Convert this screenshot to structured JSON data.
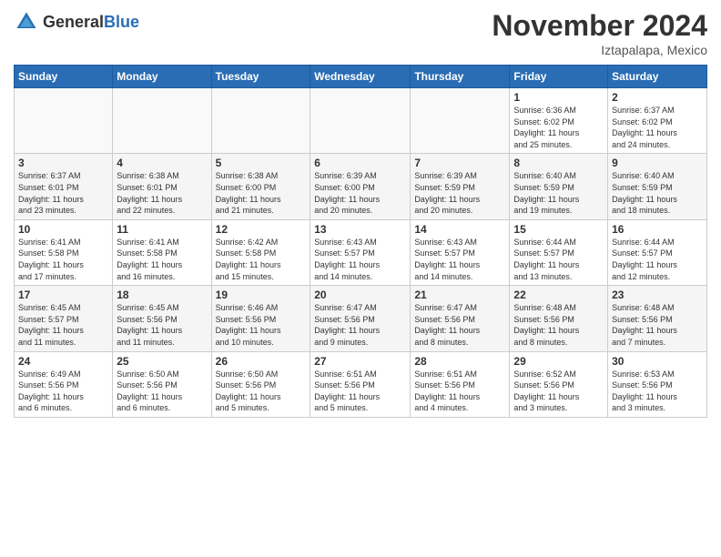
{
  "logo": {
    "text_general": "General",
    "text_blue": "Blue"
  },
  "title": "November 2024",
  "location": "Iztapalapa, Mexico",
  "days_of_week": [
    "Sunday",
    "Monday",
    "Tuesday",
    "Wednesday",
    "Thursday",
    "Friday",
    "Saturday"
  ],
  "weeks": [
    {
      "days": [
        {
          "num": "",
          "info": ""
        },
        {
          "num": "",
          "info": ""
        },
        {
          "num": "",
          "info": ""
        },
        {
          "num": "",
          "info": ""
        },
        {
          "num": "",
          "info": ""
        },
        {
          "num": "1",
          "info": "Sunrise: 6:36 AM\nSunset: 6:02 PM\nDaylight: 11 hours\nand 25 minutes."
        },
        {
          "num": "2",
          "info": "Sunrise: 6:37 AM\nSunset: 6:02 PM\nDaylight: 11 hours\nand 24 minutes."
        }
      ]
    },
    {
      "days": [
        {
          "num": "3",
          "info": "Sunrise: 6:37 AM\nSunset: 6:01 PM\nDaylight: 11 hours\nand 23 minutes."
        },
        {
          "num": "4",
          "info": "Sunrise: 6:38 AM\nSunset: 6:01 PM\nDaylight: 11 hours\nand 22 minutes."
        },
        {
          "num": "5",
          "info": "Sunrise: 6:38 AM\nSunset: 6:00 PM\nDaylight: 11 hours\nand 21 minutes."
        },
        {
          "num": "6",
          "info": "Sunrise: 6:39 AM\nSunset: 6:00 PM\nDaylight: 11 hours\nand 20 minutes."
        },
        {
          "num": "7",
          "info": "Sunrise: 6:39 AM\nSunset: 5:59 PM\nDaylight: 11 hours\nand 20 minutes."
        },
        {
          "num": "8",
          "info": "Sunrise: 6:40 AM\nSunset: 5:59 PM\nDaylight: 11 hours\nand 19 minutes."
        },
        {
          "num": "9",
          "info": "Sunrise: 6:40 AM\nSunset: 5:59 PM\nDaylight: 11 hours\nand 18 minutes."
        }
      ]
    },
    {
      "days": [
        {
          "num": "10",
          "info": "Sunrise: 6:41 AM\nSunset: 5:58 PM\nDaylight: 11 hours\nand 17 minutes."
        },
        {
          "num": "11",
          "info": "Sunrise: 6:41 AM\nSunset: 5:58 PM\nDaylight: 11 hours\nand 16 minutes."
        },
        {
          "num": "12",
          "info": "Sunrise: 6:42 AM\nSunset: 5:58 PM\nDaylight: 11 hours\nand 15 minutes."
        },
        {
          "num": "13",
          "info": "Sunrise: 6:43 AM\nSunset: 5:57 PM\nDaylight: 11 hours\nand 14 minutes."
        },
        {
          "num": "14",
          "info": "Sunrise: 6:43 AM\nSunset: 5:57 PM\nDaylight: 11 hours\nand 14 minutes."
        },
        {
          "num": "15",
          "info": "Sunrise: 6:44 AM\nSunset: 5:57 PM\nDaylight: 11 hours\nand 13 minutes."
        },
        {
          "num": "16",
          "info": "Sunrise: 6:44 AM\nSunset: 5:57 PM\nDaylight: 11 hours\nand 12 minutes."
        }
      ]
    },
    {
      "days": [
        {
          "num": "17",
          "info": "Sunrise: 6:45 AM\nSunset: 5:57 PM\nDaylight: 11 hours\nand 11 minutes."
        },
        {
          "num": "18",
          "info": "Sunrise: 6:45 AM\nSunset: 5:56 PM\nDaylight: 11 hours\nand 11 minutes."
        },
        {
          "num": "19",
          "info": "Sunrise: 6:46 AM\nSunset: 5:56 PM\nDaylight: 11 hours\nand 10 minutes."
        },
        {
          "num": "20",
          "info": "Sunrise: 6:47 AM\nSunset: 5:56 PM\nDaylight: 11 hours\nand 9 minutes."
        },
        {
          "num": "21",
          "info": "Sunrise: 6:47 AM\nSunset: 5:56 PM\nDaylight: 11 hours\nand 8 minutes."
        },
        {
          "num": "22",
          "info": "Sunrise: 6:48 AM\nSunset: 5:56 PM\nDaylight: 11 hours\nand 8 minutes."
        },
        {
          "num": "23",
          "info": "Sunrise: 6:48 AM\nSunset: 5:56 PM\nDaylight: 11 hours\nand 7 minutes."
        }
      ]
    },
    {
      "days": [
        {
          "num": "24",
          "info": "Sunrise: 6:49 AM\nSunset: 5:56 PM\nDaylight: 11 hours\nand 6 minutes."
        },
        {
          "num": "25",
          "info": "Sunrise: 6:50 AM\nSunset: 5:56 PM\nDaylight: 11 hours\nand 6 minutes."
        },
        {
          "num": "26",
          "info": "Sunrise: 6:50 AM\nSunset: 5:56 PM\nDaylight: 11 hours\nand 5 minutes."
        },
        {
          "num": "27",
          "info": "Sunrise: 6:51 AM\nSunset: 5:56 PM\nDaylight: 11 hours\nand 5 minutes."
        },
        {
          "num": "28",
          "info": "Sunrise: 6:51 AM\nSunset: 5:56 PM\nDaylight: 11 hours\nand 4 minutes."
        },
        {
          "num": "29",
          "info": "Sunrise: 6:52 AM\nSunset: 5:56 PM\nDaylight: 11 hours\nand 3 minutes."
        },
        {
          "num": "30",
          "info": "Sunrise: 6:53 AM\nSunset: 5:56 PM\nDaylight: 11 hours\nand 3 minutes."
        }
      ]
    }
  ]
}
